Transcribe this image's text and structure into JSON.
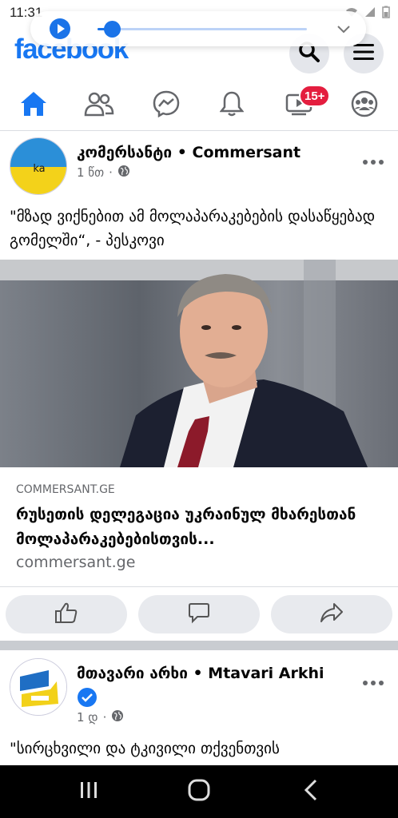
{
  "status_bar": {
    "time": "11:31"
  },
  "header": {
    "logo": "facebook",
    "icons": [
      "search-icon",
      "menu-icon"
    ]
  },
  "nav": {
    "items": [
      "home-icon",
      "friends-icon",
      "messenger-icon",
      "notifications-icon",
      "watch-icon",
      "groups-icon"
    ],
    "watch_badge": "15+",
    "active": "home"
  },
  "post1": {
    "author": "კომერსანტი • Commersant",
    "time": "1 წთ",
    "text": "\"მზად ვიქნებით ამ მოლაპარაკებების დასაწყებად გომელში“, - პესკოვი",
    "link": {
      "domain_top": "COMMERSANT.GE",
      "title": "რუსეთის დელეგაცია უკრაინულ მხარესთან მოლაპარაკებებისთვის...",
      "domain_bottom": "commersant.ge"
    },
    "avatar_text": "ka"
  },
  "post2": {
    "author": "მთავარი არხი • Mtavari Arkhi",
    "time": "1 დ",
    "text": "\"სირცხვილი და ტკივილი თქვენთვის"
  },
  "colors": {
    "brand": "#1877f2",
    "badge": "#e41e3f",
    "secondary_text": "#65676b"
  },
  "media": {
    "progress": 0.07
  }
}
